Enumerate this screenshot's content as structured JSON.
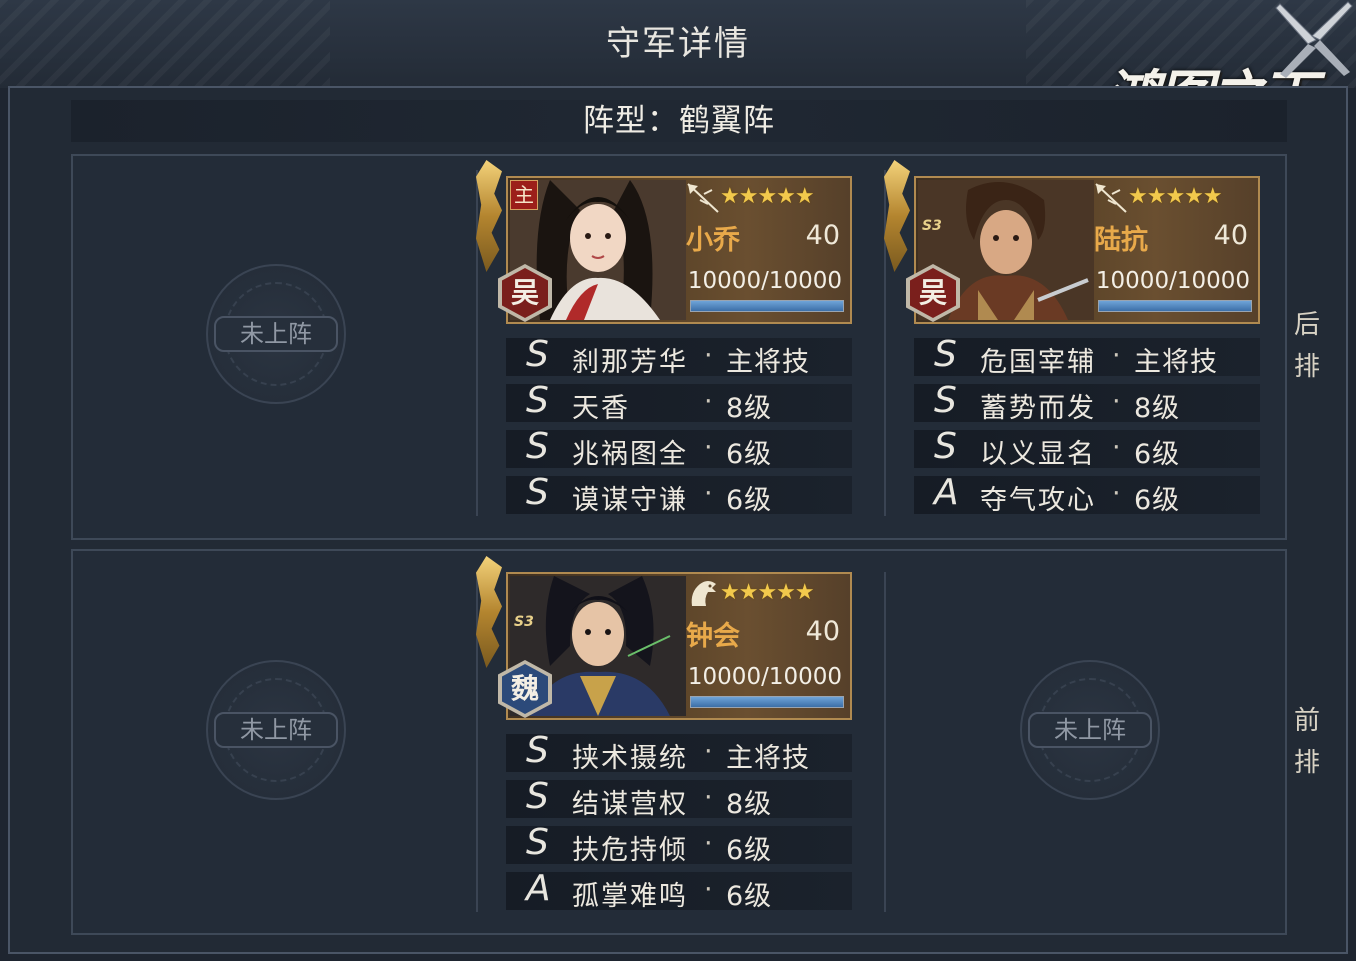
{
  "header": {
    "title": "守军详情",
    "logo_text": "鸿图之下"
  },
  "formation": {
    "label": "阵型：鹤翼阵"
  },
  "rows": {
    "back_label": [
      "后",
      "排"
    ],
    "front_label": [
      "前",
      "排"
    ]
  },
  "empty_slot_label": "未上阵",
  "generals": [
    {
      "name": "小乔",
      "level": "40",
      "stars": "★★★★★",
      "hp": "10000/10000",
      "hp_fraction": 1.0,
      "faction": "吴",
      "faction_color": "#7a1f1c",
      "lord_badge": "主",
      "skills": [
        {
          "grade": "S",
          "name": "刹那芳华",
          "level": "主将技"
        },
        {
          "grade": "S",
          "name": "天香",
          "level": "8级"
        },
        {
          "grade": "S",
          "name": "兆祸图全",
          "level": "6级"
        },
        {
          "grade": "S",
          "name": "谟谋守谦",
          "level": "6级"
        }
      ]
    },
    {
      "name": "陆抗",
      "level": "40",
      "stars": "★★★★★",
      "hp": "10000/10000",
      "hp_fraction": 1.0,
      "faction": "吴",
      "faction_color": "#7a1f1c",
      "season_badge": "S3",
      "skills": [
        {
          "grade": "S",
          "name": "危国宰辅",
          "level": "主将技"
        },
        {
          "grade": "S",
          "name": "蓄势而发",
          "level": "8级"
        },
        {
          "grade": "S",
          "name": "以义显名",
          "level": "6级"
        },
        {
          "grade": "A",
          "name": "夺气攻心",
          "level": "6级"
        }
      ]
    },
    {
      "name": "钟会",
      "level": "40",
      "stars": "★★★★★",
      "hp": "10000/10000",
      "hp_fraction": 1.0,
      "faction": "魏",
      "faction_color": "#2c4a7a",
      "season_badge": "S3",
      "skills": [
        {
          "grade": "S",
          "name": "挟术摄统",
          "level": "主将技"
        },
        {
          "grade": "S",
          "name": "结谋营权",
          "level": "8级"
        },
        {
          "grade": "S",
          "name": "扶危持倾",
          "level": "6级"
        },
        {
          "grade": "A",
          "name": "孤掌难鸣",
          "level": "6级"
        }
      ]
    }
  ],
  "icons": {
    "class_icon": "spear-icon",
    "class_icon_cavalry": "horse-icon",
    "close_icon": "crossed-blades-icon"
  }
}
